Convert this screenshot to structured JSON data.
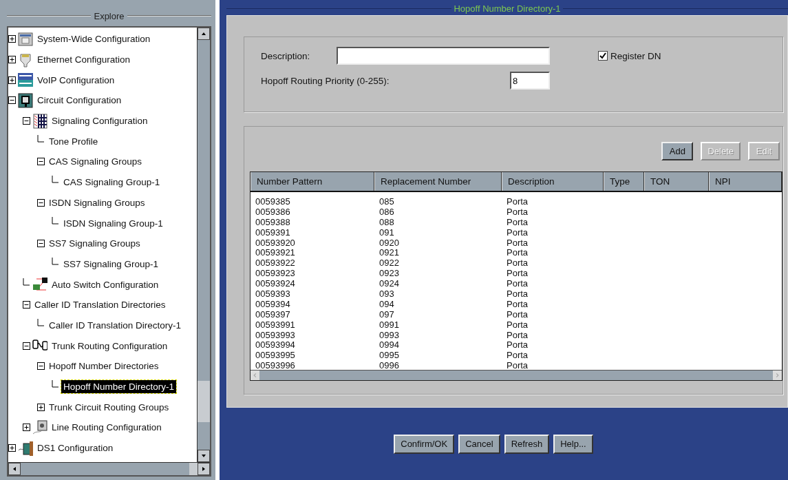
{
  "explorer": {
    "title": "Explore",
    "tree": [
      {
        "label": "System-Wide Configuration",
        "kind": "system",
        "expanded": false,
        "selected": false
      },
      {
        "label": "Ethernet Configuration",
        "kind": "ethernet",
        "expanded": false,
        "selected": false
      },
      {
        "label": "VoIP Configuration",
        "kind": "voip",
        "expanded": false,
        "selected": false
      },
      {
        "label": "Circuit Configuration",
        "kind": "circuit",
        "expanded": true,
        "selected": false,
        "children": [
          {
            "label": "Signaling Configuration",
            "kind": "grid",
            "expanded": true,
            "selected": false,
            "children": [
              {
                "label": "Tone Profile",
                "selected": false
              },
              {
                "label": "CAS Signaling Groups",
                "expanded": true,
                "selected": false,
                "children": [
                  {
                    "label": "CAS Signaling Group-1",
                    "selected": false
                  }
                ]
              },
              {
                "label": "ISDN Signaling Groups",
                "expanded": true,
                "selected": false,
                "children": [
                  {
                    "label": "ISDN Signaling Group-1",
                    "selected": false
                  }
                ]
              },
              {
                "label": "SS7 Signaling Groups",
                "expanded": true,
                "selected": false,
                "children": [
                  {
                    "label": "SS7 Signaling Group-1",
                    "selected": false
                  }
                ]
              }
            ]
          },
          {
            "label": "Auto Switch Configuration",
            "kind": "switch",
            "selected": false
          },
          {
            "label": "Caller ID Translation Directories",
            "expanded": true,
            "selected": false,
            "children": [
              {
                "label": "Caller ID Translation Directory-1",
                "selected": false
              }
            ]
          },
          {
            "label": "Trunk Routing Configuration",
            "kind": "trunk",
            "expanded": true,
            "selected": false,
            "children": [
              {
                "label": "Hopoff Number Directories",
                "expanded": true,
                "selected": false,
                "children": [
                  {
                    "label": "Hopoff Number Directory-1",
                    "selected": true
                  }
                ]
              },
              {
                "label": "Trunk Circuit Routing Groups",
                "expanded": false,
                "selected": false
              }
            ]
          },
          {
            "label": "Line Routing Configuration",
            "kind": "line",
            "expanded": false,
            "selected": false
          }
        ]
      },
      {
        "label": "DS1 Configuration",
        "kind": "connector",
        "expanded": false,
        "selected": false
      }
    ]
  },
  "panel": {
    "title": "Hopoff Number Directory-1",
    "description": {
      "label": "Description:"
    },
    "register_dn": {
      "label": "Register DN",
      "checked": true
    },
    "priority": {
      "label": "Hopoff Routing Priority (0-255):",
      "value": "8"
    },
    "table_buttons": [
      {
        "label": "Add",
        "disabled": false
      },
      {
        "label": "Delete",
        "disabled": true
      },
      {
        "label": "Edit",
        "disabled": true
      }
    ],
    "table": {
      "columns": [
        "Number Pattern",
        "Replacement Number",
        "Description",
        "Type",
        "TON",
        "NPI"
      ],
      "rows": [
        [
          "0059385",
          "085",
          "Porta"
        ],
        [
          "0059386",
          "086",
          "Porta"
        ],
        [
          "0059388",
          "088",
          "Porta"
        ],
        [
          "0059391",
          "091",
          "Porta"
        ],
        [
          "00593920",
          "0920",
          "Porta"
        ],
        [
          "00593921",
          "0921",
          "Porta"
        ],
        [
          "00593922",
          "0922",
          "Porta"
        ],
        [
          "00593923",
          "0923",
          "Porta"
        ],
        [
          "00593924",
          "0924",
          "Porta"
        ],
        [
          "0059393",
          "093",
          "Porta"
        ],
        [
          "0059394",
          "094",
          "Porta"
        ],
        [
          "0059397",
          "097",
          "Porta"
        ],
        [
          "00593991",
          "0991",
          "Porta"
        ],
        [
          "00593993",
          "0993",
          "Porta"
        ],
        [
          "00593994",
          "0994",
          "Porta"
        ],
        [
          "00593995",
          "0995",
          "Porta"
        ],
        [
          "00593996",
          "0996",
          "Porta"
        ]
      ]
    },
    "buttons": [
      "Confirm/OK",
      "Cancel",
      "Refresh",
      "Help..."
    ]
  }
}
